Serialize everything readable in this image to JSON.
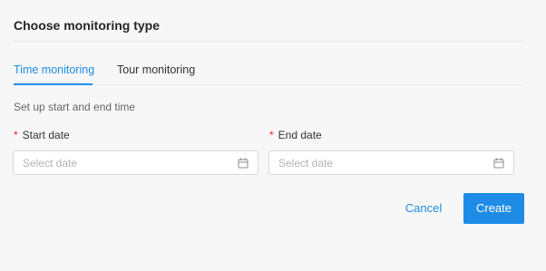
{
  "dialog": {
    "title": "Choose monitoring type"
  },
  "tabs": [
    {
      "label": "Time monitoring",
      "active": true
    },
    {
      "label": "Tour monitoring",
      "active": false
    }
  ],
  "form": {
    "hint": "Set up start and end time",
    "required_marker": "*",
    "start_date": {
      "label": "Start date",
      "placeholder": "Select date",
      "icon": "calendar-icon"
    },
    "end_date": {
      "label": "End date",
      "placeholder": "Select date",
      "icon": "calendar-icon"
    }
  },
  "actions": {
    "cancel_label": "Cancel",
    "create_label": "Create"
  },
  "colors": {
    "accent": "#1e8ce6",
    "required": "#f5222d",
    "background": "#f7f7f7"
  }
}
